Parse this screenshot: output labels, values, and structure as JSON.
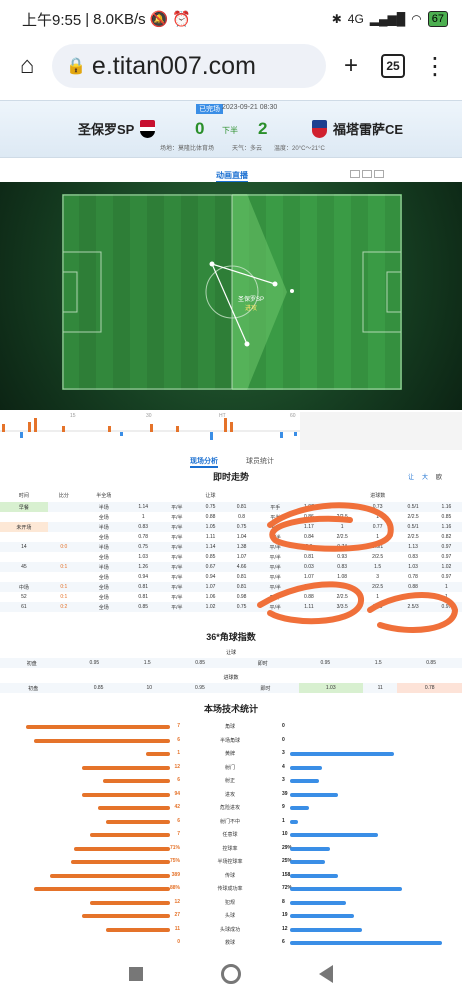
{
  "status_bar": {
    "time": "上午9:55",
    "speed": "8.0KB/s",
    "signal": "4G",
    "battery": "67"
  },
  "browser": {
    "url": "e.titan007.com",
    "tab_count": "25"
  },
  "match": {
    "tag": "已完场",
    "datetime": "2023-09-21 08:30",
    "home": "圣保罗SP",
    "away": "福塔雷萨CE",
    "home_score": "0",
    "away_score": "2",
    "period": "下半",
    "venue": "场地：莫隆比体育场",
    "weather": "天气：多云",
    "temperature": "温度：20°C～21°C"
  },
  "anim": {
    "title": "动画直播",
    "team_label": "圣保罗SP",
    "event": "进攻"
  },
  "timeline": {
    "ticks": [
      "15",
      "30",
      "HT",
      "60",
      "75",
      "90"
    ]
  },
  "tabs2": {
    "a": "现场分析",
    "b": "球员统计"
  },
  "odds": {
    "title": "即时走势",
    "filters": [
      "让",
      "大",
      "欧"
    ],
    "group_a": "让球",
    "group_b": "进球数",
    "headers": [
      "时间",
      "比分",
      "半全场",
      "开盘",
      "即时",
      "即时"
    ],
    "rows": [
      [
        "早餐",
        "",
        "半场",
        "1.14",
        "平/半",
        "0.75",
        "0.81",
        "平手",
        "1.07",
        "1",
        "0.73",
        "0.5/1",
        "1.16"
      ],
      [
        "",
        "",
        "全场",
        "1",
        "平/半",
        "0.88",
        "0.8",
        "平半",
        "0.86",
        "2/2.5",
        "1",
        "2/2.5",
        "0.85"
      ],
      [
        "未开场",
        "",
        "半场",
        "0.83",
        "平/半",
        "1.05",
        "0.75",
        "平手",
        "1.17",
        "1",
        "0.77",
        "0.5/1",
        "1.16"
      ],
      [
        "",
        "",
        "全场",
        "0.78",
        "平/半",
        "1.11",
        "1.04",
        "平/半",
        "0.84",
        "2/2.5",
        "1",
        "2/2.5",
        "0.82"
      ],
      [
        "14",
        "0:0",
        "半场",
        "0.75",
        "平/半",
        "1.14",
        "1.38",
        "平/半",
        "0.6",
        "0.74",
        "0.5/1",
        "1.13",
        "0.97"
      ],
      [
        "",
        "",
        "全场",
        "1.03",
        "平/半",
        "0.85",
        "1.07",
        "平/半",
        "0.81",
        "0.93",
        "2/2.5",
        "0.83",
        "0.97"
      ],
      [
        "45",
        "0:1",
        "半场",
        "1.26",
        "平/半",
        "0.67",
        "4.66",
        "平/半",
        "0.03",
        "0.83",
        "1.5",
        "1.03",
        "1.02"
      ],
      [
        "",
        "",
        "全场",
        "0.94",
        "平/半",
        "0.94",
        "0.81",
        "平/半",
        "1.07",
        "1.08",
        "3",
        "0.78",
        "0.97"
      ],
      [
        "中场",
        "0:1",
        "全场",
        "0.81",
        "平/半",
        "1.07",
        "0.81",
        "平/半",
        "1.06",
        "1",
        "2/2.5",
        "0.88",
        "1"
      ],
      [
        "52",
        "0:1",
        "全场",
        "0.81",
        "平/半",
        "1.06",
        "0.98",
        "平/半",
        "0.88",
        "2/2.5",
        "1",
        "2/2.5",
        "1"
      ],
      [
        "61",
        "0:2",
        "全场",
        "0.85",
        "平/半",
        "1.02",
        "0.75",
        "平/半",
        "1.11",
        "3/3.5",
        "0.89",
        "2.5/3",
        "0.97"
      ]
    ]
  },
  "corner": {
    "title": "36*角球指数",
    "sub_a": "让球",
    "sub_b": "进球数",
    "row1": [
      "初盘",
      "0.95",
      "1.5",
      "0.85",
      "即时",
      "0.95",
      "1.5",
      "0.85"
    ],
    "row2": [
      "初盘",
      "0.85",
      "10",
      "0.95",
      "即时",
      "1.03",
      "11",
      "0.78"
    ]
  },
  "stats": {
    "title": "本场技术统计",
    "home_color": "#e5732a",
    "away_color": "#3a8ee6",
    "items": [
      {
        "label": "角球",
        "home": "7",
        "away": "0",
        "h": 0.9,
        "a": 0.0
      },
      {
        "label": "半场角球",
        "home": "6",
        "away": "0",
        "h": 0.85,
        "a": 0.0
      },
      {
        "label": "黄牌",
        "home": "1",
        "away": "3",
        "h": 0.15,
        "a": 0.65
      },
      {
        "label": "射门",
        "home": "12",
        "away": "4",
        "h": 0.55,
        "a": 0.2
      },
      {
        "label": "射正",
        "home": "6",
        "away": "3",
        "h": 0.42,
        "a": 0.18
      },
      {
        "label": "进攻",
        "home": "94",
        "away": "39",
        "h": 0.55,
        "a": 0.3
      },
      {
        "label": "危险进攻",
        "home": "42",
        "away": "9",
        "h": 0.45,
        "a": 0.12
      },
      {
        "label": "射门不中",
        "home": "6",
        "away": "1",
        "h": 0.4,
        "a": 0.05
      },
      {
        "label": "任意球",
        "home": "7",
        "away": "10",
        "h": 0.5,
        "a": 0.55
      },
      {
        "label": "控球率",
        "home": "71%",
        "away": "29%",
        "h": 0.6,
        "a": 0.25
      },
      {
        "label": "半场控球率",
        "home": "75%",
        "away": "25%",
        "h": 0.62,
        "a": 0.22
      },
      {
        "label": "传球",
        "home": "389",
        "away": "158",
        "h": 0.75,
        "a": 0.3
      },
      {
        "label": "传球成功率",
        "home": "88%",
        "away": "72%",
        "h": 0.85,
        "a": 0.7
      },
      {
        "label": "犯规",
        "home": "12",
        "away": "8",
        "h": 0.5,
        "a": 0.35
      },
      {
        "label": "头球",
        "home": "27",
        "away": "19",
        "h": 0.55,
        "a": 0.4
      },
      {
        "label": "头球成功",
        "home": "11",
        "away": "12",
        "h": 0.4,
        "a": 0.45
      },
      {
        "label": "救球",
        "home": "0",
        "away": "6",
        "h": 0.0,
        "a": 0.95
      }
    ]
  }
}
